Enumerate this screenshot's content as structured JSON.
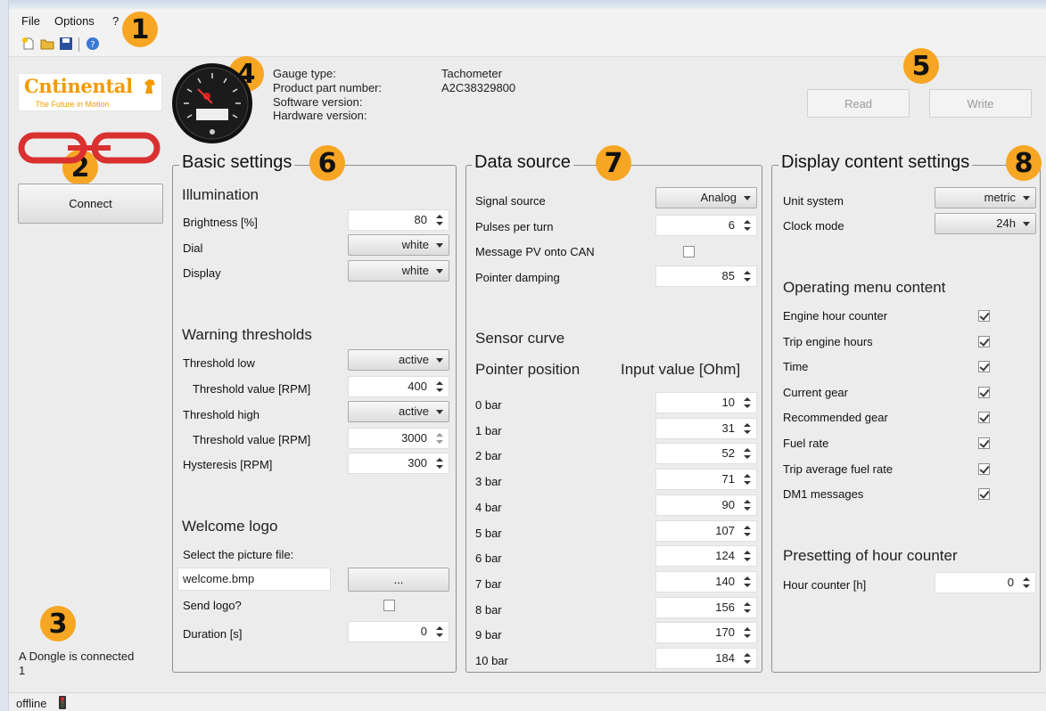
{
  "menu": {
    "file": "File",
    "options": "Options",
    "help": "?"
  },
  "callouts": [
    "1",
    "2",
    "3",
    "4",
    "5",
    "6",
    "7",
    "8"
  ],
  "logo": {
    "brand": "ntinental",
    "brand_first": "C",
    "tagline": "The Future in Motion"
  },
  "left": {
    "connect_label": "Connect",
    "status_line1": "A Dongle is connected",
    "status_line2": "1"
  },
  "header": {
    "gauge_type_label": "Gauge type:",
    "gauge_type_value": "Tachometer",
    "part_number_label": "Product part number:",
    "part_number_value": "A2C38329800",
    "software_label": "Software version:",
    "hardware_label": "Hardware version:",
    "read_label": "Read",
    "write_label": "Write"
  },
  "basic": {
    "title": "Basic settings",
    "illumination": "Illumination",
    "brightness_label": "Brightness [%]",
    "brightness_value": "80",
    "dial_label": "Dial",
    "dial_value": "white",
    "display_label": "Display",
    "display_value": "white",
    "warning": "Warning thresholds",
    "threshold_low_label": "Threshold low",
    "threshold_low_value": "active",
    "threshold_low_rpm_label": "Threshold value [RPM]",
    "threshold_low_rpm_value": "400",
    "threshold_high_label": "Threshold high",
    "threshold_high_value": "active",
    "threshold_high_rpm_label": "Threshold value [RPM]",
    "threshold_high_rpm_value": "3000",
    "hysteresis_label": "Hysteresis [RPM]",
    "hysteresis_value": "300",
    "welcome": "Welcome logo",
    "select_file_label": "Select the picture file:",
    "file_value": "welcome.bmp",
    "browse_label": "...",
    "send_logo_label": "Send logo?",
    "send_logo_checked": false,
    "duration_label": "Duration [s]",
    "duration_value": "0"
  },
  "datasource": {
    "title": "Data source",
    "signal_source_label": "Signal source",
    "signal_source_value": "Analog",
    "pulses_label": "Pulses per turn",
    "pulses_value": "6",
    "message_pv_label": "Message PV onto CAN",
    "message_pv_checked": false,
    "damping_label": "Pointer damping",
    "damping_value": "85",
    "sensor_curve": "Sensor curve",
    "col_pointer": "Pointer position",
    "col_input": "Input value [Ohm]",
    "rows": [
      {
        "pos": "0 bar",
        "value": "10"
      },
      {
        "pos": "1 bar",
        "value": "31"
      },
      {
        "pos": "2 bar",
        "value": "52"
      },
      {
        "pos": "3 bar",
        "value": "71"
      },
      {
        "pos": "4 bar",
        "value": "90"
      },
      {
        "pos": "5 bar",
        "value": "107"
      },
      {
        "pos": "6 bar",
        "value": "124"
      },
      {
        "pos": "7 bar",
        "value": "140"
      },
      {
        "pos": "8 bar",
        "value": "156"
      },
      {
        "pos": "9 bar",
        "value": "170"
      },
      {
        "pos": "10 bar",
        "value": "184"
      }
    ]
  },
  "display": {
    "title": "Display content settings",
    "unit_label": "Unit system",
    "unit_value": "metric",
    "clock_label": "Clock mode",
    "clock_value": "24h",
    "operating_menu": "Operating menu content",
    "items": [
      {
        "label": "Engine hour counter",
        "checked": true
      },
      {
        "label": "Trip engine hours",
        "checked": true
      },
      {
        "label": "Time",
        "checked": true
      },
      {
        "label": "Current gear",
        "checked": true
      },
      {
        "label": "Recommended gear",
        "checked": true
      },
      {
        "label": "Fuel rate",
        "checked": true
      },
      {
        "label": "Trip average fuel rate",
        "checked": true
      },
      {
        "label": "DM1 messages",
        "checked": true
      }
    ],
    "presetting": "Presetting of hour counter",
    "hour_counter_label": "Hour counter [h]",
    "hour_counter_value": "0"
  },
  "statusbar": {
    "text": "offline"
  }
}
